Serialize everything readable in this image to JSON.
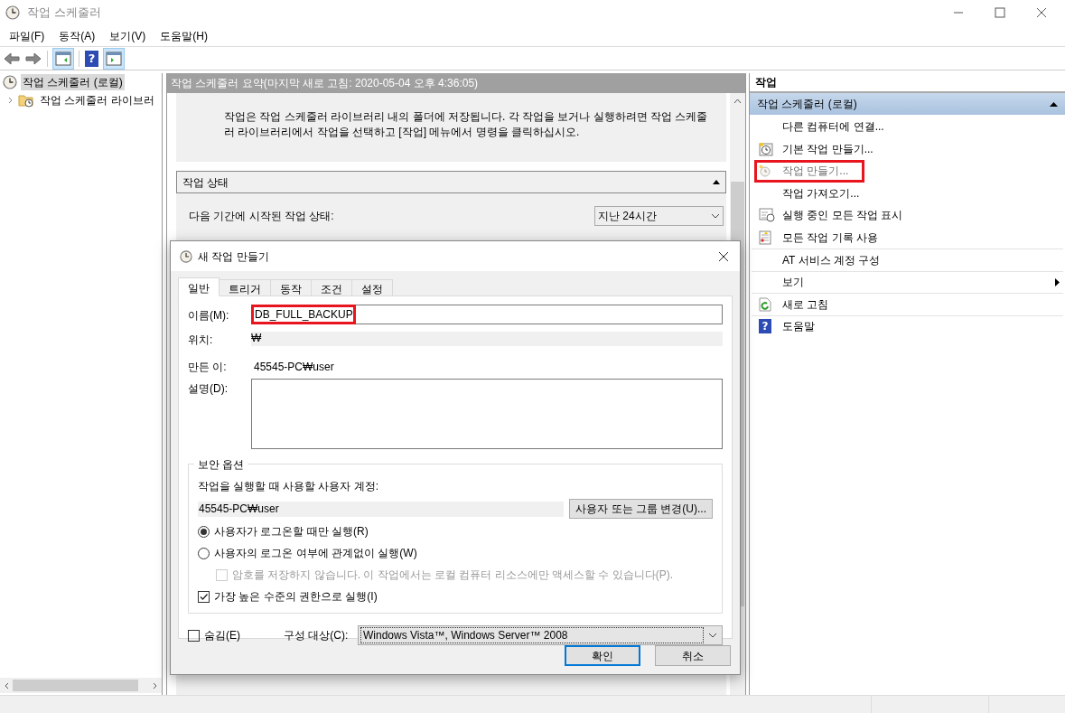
{
  "window": {
    "title": "작업 스케줄러"
  },
  "menu": [
    "파일(F)",
    "동작(A)",
    "보기(V)",
    "도움말(H)"
  ],
  "toolbar": [
    {
      "kind": "back"
    },
    {
      "kind": "forward"
    },
    {
      "kind": "left_pane",
      "on": true
    },
    {
      "kind": "help",
      "glyph": "?"
    },
    {
      "kind": "right_pane",
      "on": true
    }
  ],
  "tree": [
    {
      "label": "작업 스케줄러 (로컬)",
      "selected": true,
      "children": [
        {
          "label": "작업 스케줄러 라이브러",
          "selected": false,
          "expanded": false
        }
      ]
    }
  ],
  "summary": {
    "header": "작업 스케줄러 요약(마지막 새로 고침: 2020-05-04 오후 4:36:05)",
    "description": "작업은 작업 스케줄러 라이브러리 내의 폴더에 저장됩니다. 각 작업을 보거나 실행하려면 작업 스케줄러 라이브러리에서 작업을 선택하고 [작업] 메뉴에서 명령을 클릭하십시오.",
    "status_section": {
      "title": "작업 상태",
      "expanded": true,
      "period_label": "다음 기간에 시작된 작업 상태:",
      "period_value": "지난 24시간"
    }
  },
  "actions": {
    "title": "작업",
    "section": {
      "title": "작업 스케줄러 (로컬)",
      "expanded": true
    },
    "groups": [
      [
        {
          "kind": "text",
          "label": "다른 컴퓨터에 연결...",
          "disabled": false,
          "highlighted": false
        },
        {
          "kind": "basic_task",
          "label": "기본 작업 만들기...",
          "disabled": false,
          "highlighted": false
        },
        {
          "kind": "create_task",
          "label": "작업 만들기...",
          "disabled": true,
          "highlighted": true
        },
        {
          "kind": "text",
          "label": "작업 가져오기...",
          "disabled": false,
          "highlighted": false
        },
        {
          "kind": "running",
          "label": "실행 중인 모든 작업 표시",
          "disabled": false,
          "highlighted": false
        },
        {
          "kind": "history",
          "label": "모든 작업 기록 사용",
          "disabled": false,
          "highlighted": false
        }
      ],
      [
        {
          "kind": "text",
          "label": "AT 서비스 계정 구성",
          "disabled": false,
          "highlighted": false
        }
      ],
      [
        {
          "kind": "submenu",
          "label": "보기",
          "disabled": false,
          "highlighted": false
        }
      ],
      [
        {
          "kind": "refresh",
          "label": "새로 고침",
          "disabled": false,
          "highlighted": false
        }
      ],
      [
        {
          "kind": "help",
          "glyph": "?",
          "label": "도움말",
          "disabled": false,
          "highlighted": false
        }
      ]
    ]
  },
  "dialog": {
    "title": "새 작업 만들기",
    "tabs": [
      {
        "label": "일반",
        "selected": true
      },
      {
        "label": "트리거",
        "selected": false
      },
      {
        "label": "동작",
        "selected": false
      },
      {
        "label": "조건",
        "selected": false
      },
      {
        "label": "설정",
        "selected": false
      }
    ],
    "fields": {
      "name_label": "이름(M):",
      "name_value": "DB_FULL_BACKUP",
      "name_highlighted": true,
      "location_label": "위치:",
      "location_value": "₩",
      "author_label": "만든 이:",
      "author_value": "45545-PC₩user",
      "description_label": "설명(D):"
    },
    "security": {
      "title": "보안 옵션",
      "account_label": "작업을 실행할 때 사용할 사용자 계정:",
      "account_value": "45545-PC₩user",
      "change_button": "사용자 또는 그룹 변경(U)...",
      "options": [
        {
          "kind": "radio",
          "label": "사용자가 로그온할 때만 실행(R)",
          "selected": true,
          "disabled": false
        },
        {
          "kind": "radio",
          "label": "사용자의 로그온 여부에 관계없이 실행(W)",
          "selected": false,
          "disabled": false,
          "children": [
            {
              "kind": "checkbox",
              "label": "암호를 저장하지 않습니다. 이 작업에서는 로컬 컴퓨터 리소스에만 액세스할 수 있습니다(P).",
              "checked": false,
              "disabled": true
            }
          ]
        },
        {
          "kind": "checkbox",
          "label": "가장 높은 수준의 권한으로 실행(I)",
          "checked": true,
          "disabled": false
        }
      ]
    },
    "hidden": {
      "label": "숨김(E)",
      "checked": false
    },
    "configure": {
      "label": "구성 대상(C):",
      "value": "Windows Vista™, Windows Server™ 2008"
    },
    "buttons": [
      {
        "label": "확인",
        "default": true
      },
      {
        "label": "취소",
        "default": false
      }
    ]
  }
}
